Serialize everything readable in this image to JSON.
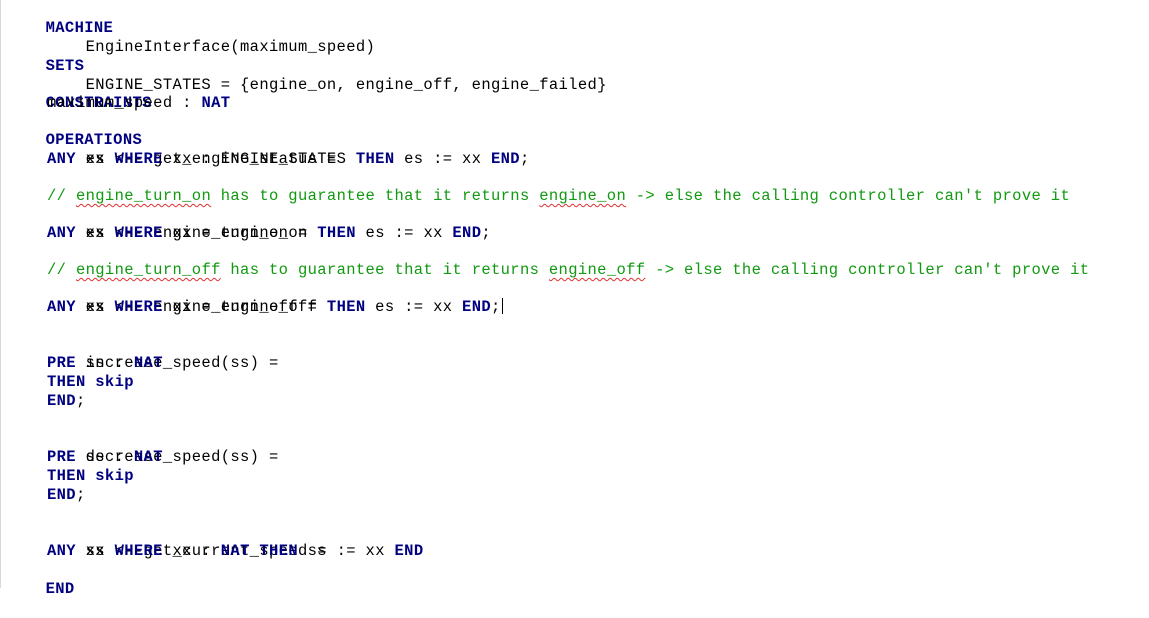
{
  "code": {
    "l1": {
      "kw": "MACHINE"
    },
    "l2": {
      "text": "EngineInterface(maximum_speed)"
    },
    "l3": {
      "kw": "SETS"
    },
    "l4": {
      "text": "ENGINE_STATES = {engine_on, engine_off, engine_failed}"
    },
    "l5": {
      "kw": "CONSTRAINTS"
    },
    "l6": {
      "text": "maximum_speed : ",
      "kw": "NAT"
    },
    "l7": {
      "kw": "OPERATIONS"
    },
    "l8": {
      "text": "es <-- get_engine_status ="
    },
    "l9": {
      "k1": "ANY",
      "t1": " xx ",
      "k2": "WHERE",
      "t2": " xx : ENGINE_STATES ",
      "k3": "THEN",
      "t3": " es := xx ",
      "k4": "END",
      "t4": ";"
    },
    "l10": {
      "prefix": "// ",
      "sq": "engine_turn_on",
      "rest": " has to guarantee that it returns ",
      "sq2": "engine_on",
      "rest2": " -> else the calling controller can't prove it"
    },
    "l11": {
      "text": "es <-- engine_turn_on ="
    },
    "l12": {
      "k1": "ANY",
      "t1": " xx ",
      "k2": "WHERE",
      "t2": " xx = engine_on ",
      "k3": "THEN",
      "t3": " es := xx ",
      "k4": "END",
      "t4": ";"
    },
    "l13": {
      "prefix": "// ",
      "sq": "engine_turn_off",
      "rest": " has to guarantee that it returns ",
      "sq2": "engine_off",
      "rest2": " -> else the calling controller can't prove it"
    },
    "l14": {
      "text": "es <-- engine_turn_off ="
    },
    "l15": {
      "k1": "ANY",
      "t1": " xx ",
      "k2": "WHERE",
      "t2": " xx = engine_off ",
      "k3": "THEN",
      "t3": " es := xx ",
      "k4": "END",
      "t4": ";"
    },
    "l16": {
      "text": "increase_speed(ss) ="
    },
    "l17": {
      "kw": "PRE",
      "text": " ss : ",
      "kw2": "NAT"
    },
    "l18": {
      "kw": "THEN",
      "text": " ",
      "kw2": "skip"
    },
    "l19": {
      "kw": "END",
      "text": ";"
    },
    "l20": {
      "text": "decrease_speed(ss) ="
    },
    "l21": {
      "kw": "PRE",
      "text": " ss : ",
      "kw2": "NAT"
    },
    "l22": {
      "kw": "THEN",
      "text": " ",
      "kw2": "skip"
    },
    "l23": {
      "kw": "END",
      "text": ";"
    },
    "l24": {
      "text": "ss <--get_current_speed ="
    },
    "l25": {
      "k1": "ANY",
      "t1": " xx ",
      "k2": "WHERE",
      "t2": " xx : ",
      "k3": "NAT",
      "t3": " ",
      "k4": "THEN",
      "t4": " ss := xx ",
      "k5": "END"
    },
    "l26": {
      "kw": "END"
    }
  },
  "colors": {
    "keyword": "#000080",
    "comment": "#119911",
    "text": "#000000",
    "spellcheck": "#e03030"
  }
}
